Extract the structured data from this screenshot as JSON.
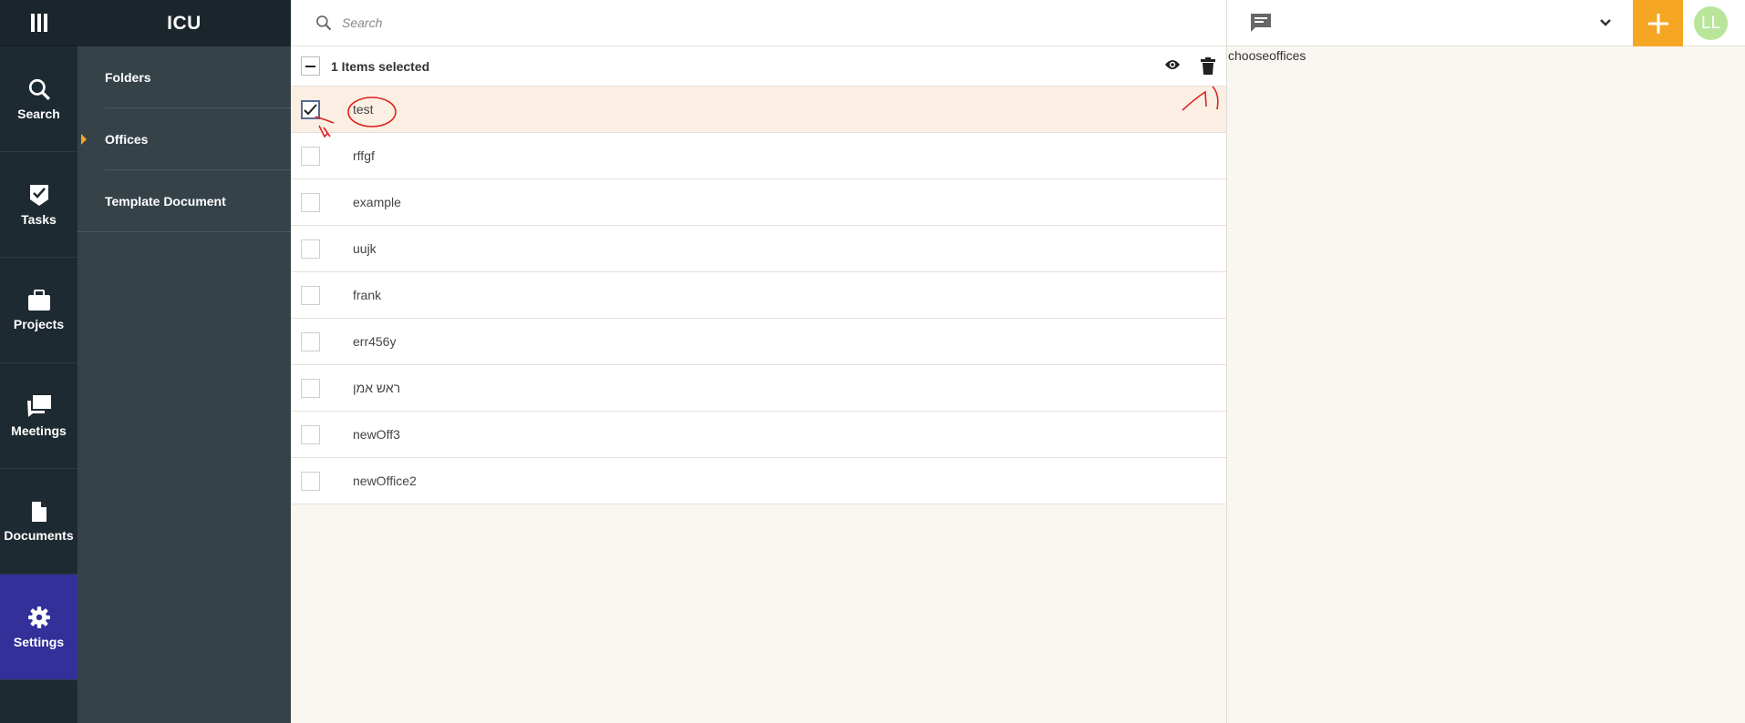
{
  "app": {
    "title": "ICU"
  },
  "nav": [
    {
      "label": "Search",
      "icon": "search-icon"
    },
    {
      "label": "Tasks",
      "icon": "tasks-icon"
    },
    {
      "label": "Projects",
      "icon": "briefcase-icon"
    },
    {
      "label": "Meetings",
      "icon": "chat-icon"
    },
    {
      "label": "Documents",
      "icon": "document-icon"
    },
    {
      "label": "Settings",
      "icon": "gear-icon",
      "active": true
    }
  ],
  "settings_menu": [
    {
      "label": "Folders"
    },
    {
      "label": "Offices",
      "active": true
    },
    {
      "label": "Template Document"
    }
  ],
  "search": {
    "placeholder": "Search"
  },
  "toolbar": {
    "selection_text": "1 Items selected"
  },
  "rows": [
    {
      "name": "test",
      "checked": true
    },
    {
      "name": "rffgf",
      "checked": false
    },
    {
      "name": "example",
      "checked": false
    },
    {
      "name": "uujk",
      "checked": false
    },
    {
      "name": "frank",
      "checked": false
    },
    {
      "name": "err456y",
      "checked": false
    },
    {
      "name": "ראש אמן",
      "checked": false
    },
    {
      "name": "newOff3",
      "checked": false
    },
    {
      "name": "newOffice2",
      "checked": false
    }
  ],
  "right_panel": {
    "info_text": "chooseoffices",
    "avatar_initials": "LL"
  },
  "colors": {
    "accent": "#f5a623",
    "active_nav": "#33309a",
    "rail": "#1e2a31",
    "sidebar": "#354349",
    "avatar": "#b9e59a",
    "annotation": "#e02020"
  }
}
